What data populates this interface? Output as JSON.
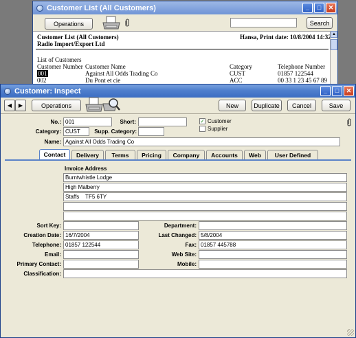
{
  "list_window": {
    "title": "Customer List (All Customers)",
    "operations_label": "Operations",
    "search_label": "Search",
    "search_value": "",
    "report_title": "Customer List (All Customers)",
    "report_print_info": "Hansa, Print date: 10/8/2004 14:32",
    "company": "Radio Import/Export Ltd",
    "list_heading": "List of Customers",
    "columns": [
      "Customer Number",
      "Customer Name",
      "Category",
      "Telephone Number"
    ],
    "rows": [
      [
        "001",
        "Against All Odds Trading Co",
        "CUST",
        "01857 122544"
      ],
      [
        "002",
        "Du Pont et cie",
        "ACC",
        "00 33 1 23 45 67 89"
      ]
    ]
  },
  "inspect_window": {
    "title": "Customer: Inspect",
    "toolbar": {
      "operations_label": "Operations",
      "new_label": "New",
      "duplicate_label": "Duplicate",
      "cancel_label": "Cancel",
      "save_label": "Save"
    },
    "header": {
      "no_label": "No.:",
      "no_value": "001",
      "short_label": "Short:",
      "short_value": "",
      "customer_label": "Customer",
      "customer_checked": true,
      "supplier_label": "Supplier",
      "supplier_checked": false,
      "category_label": "Category:",
      "category_value": "CUST",
      "supp_category_label": "Supp. Category:",
      "supp_category_value": "",
      "name_label": "Name:",
      "name_value": "Against All Odds Trading Co"
    },
    "tabs": [
      "Contact",
      "Delivery",
      "Terms",
      "Pricing",
      "Company",
      "Accounts",
      "Web",
      "User Defined"
    ],
    "active_tab": "Contact",
    "contact": {
      "invoice_address_label": "Invoice Address",
      "address_lines": [
        "Burntwhistle Lodge",
        "High Malberry",
        "Staffs    TF5 6TY",
        "",
        ""
      ],
      "sort_key_label": "Sort Key:",
      "sort_key_value": "",
      "department_label": "Department:",
      "department_value": "",
      "creation_date_label": "Creation Date:",
      "creation_date_value": "16/7/2004",
      "last_changed_label": "Last Changed:",
      "last_changed_value": "5/8/2004",
      "telephone_label": "Telephone:",
      "telephone_value": "01857 122544",
      "fax_label": "Fax:",
      "fax_value": "01857 445788",
      "email_label": "Email:",
      "email_value": "",
      "web_site_label": "Web Site:",
      "web_site_value": "",
      "primary_contact_label": "Primary Contact:",
      "primary_contact_value": "",
      "mobile_label": "Mobile:",
      "mobile_value": "",
      "classification_label": "Classification:",
      "classification_value": ""
    }
  },
  "colors": {
    "titlebar": "#3c6dc2",
    "window_bg": "#ece9d8",
    "tab_underline": "#5a82c8"
  }
}
